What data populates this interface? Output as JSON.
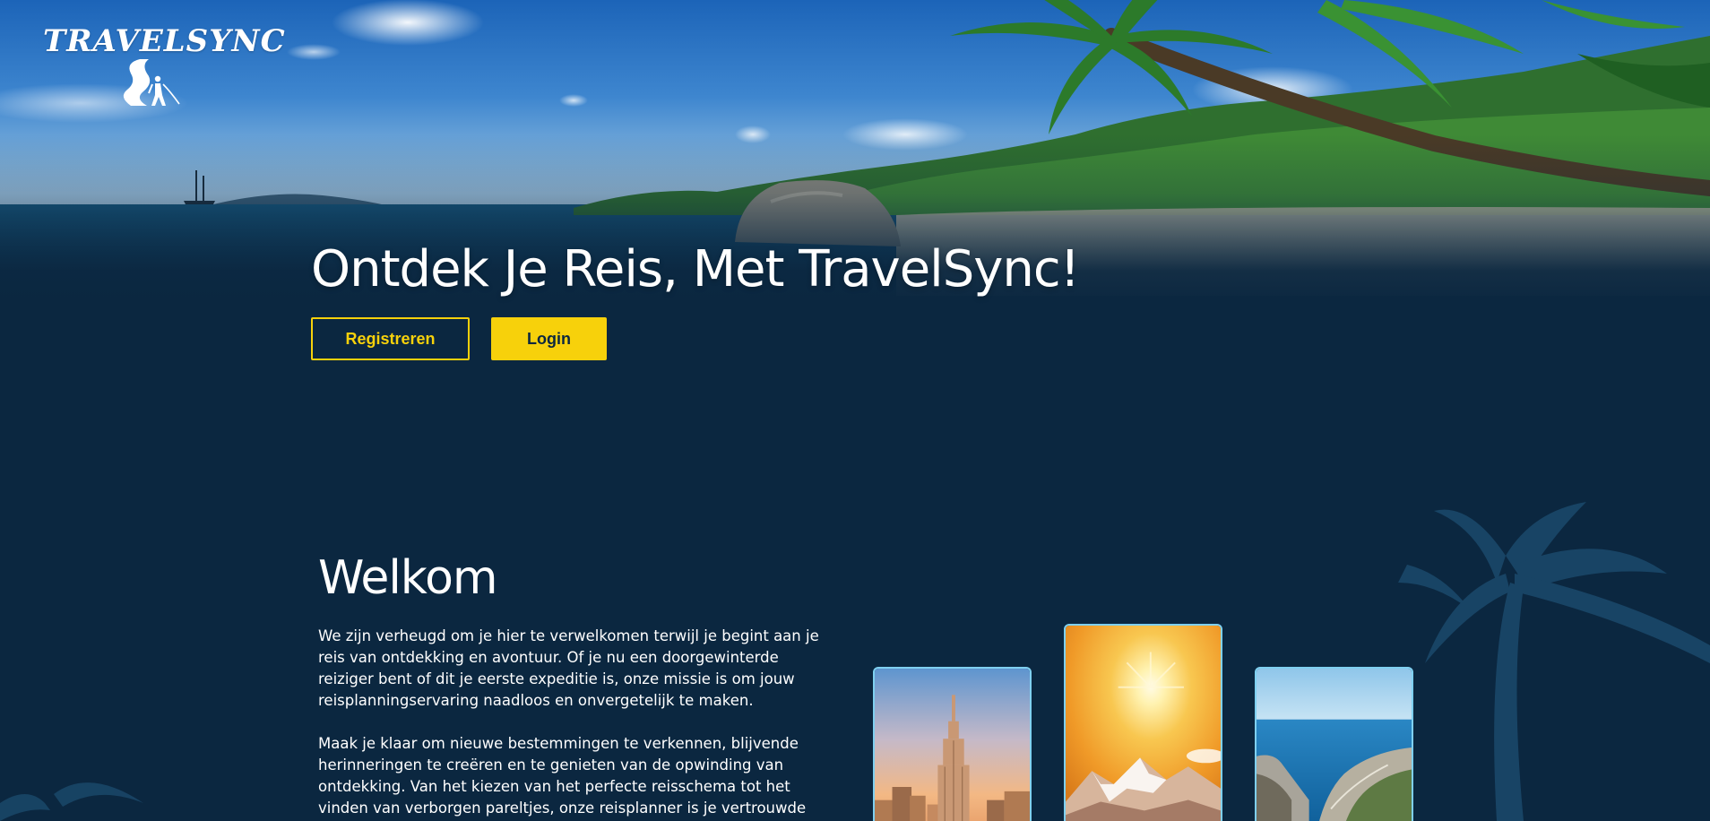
{
  "brand": {
    "name": "TRAVELSYNC",
    "accent_color": "#f7d10b",
    "background_color": "#0b2740",
    "card_border_color": "#7fd0f0"
  },
  "hero": {
    "title": "Ontdek Je Reis, Met TravelSync!",
    "register_label": "Registreren",
    "login_label": "Login",
    "background": "tropical-beach-with-palm-trees"
  },
  "welcome": {
    "title": "Welkom",
    "paragraph_1": "We zijn verheugd om je hier te verwelkomen terwijl je begint aan je reis van ontdekking en avontuur. Of je nu een doorgewinterde reiziger bent of dit je eerste expeditie is, onze missie is om jouw reisplanningservaring naadloos en onvergetelijk te maken.",
    "paragraph_2": "Maak je klaar om nieuwe bestemmingen te verkennen, blijvende herinneringen te creëren en te genieten van de opwinding van ontdekking. Van het kiezen van het perfecte reisschema tot het vinden van verborgen pareltjes, onze reisplanner is je vertrouwde"
  },
  "cards": [
    {
      "image": "city-skyline-empire-state-building"
    },
    {
      "image": "sun-over-snowy-mountains"
    },
    {
      "image": "sea-coast-cliffs"
    }
  ],
  "icons": {
    "logo_mark": "traveler-on-road-icon",
    "decor": "palm-tree-icon"
  }
}
